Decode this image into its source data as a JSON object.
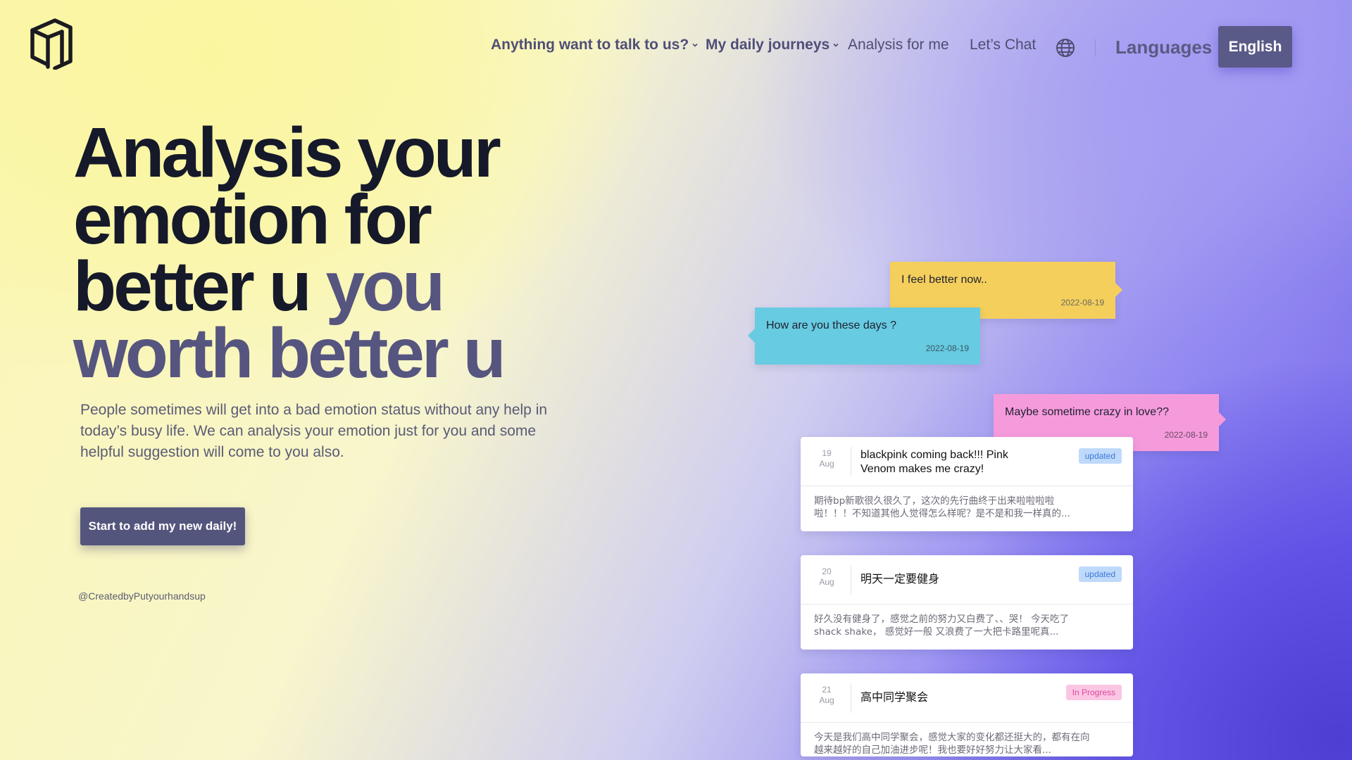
{
  "nav": {
    "items": [
      {
        "label": "Anything want to talk to us?",
        "has_dropdown": true
      },
      {
        "label": "My daily journeys",
        "has_dropdown": true
      },
      {
        "label": "Analysis for me",
        "has_dropdown": false
      },
      {
        "label": "Let’s Chat",
        "has_dropdown": false
      }
    ],
    "globe_icon": "globe-icon",
    "languages_label": "Languages",
    "language_button": "English"
  },
  "hero": {
    "title_line1": "Analysis your",
    "title_line2": "emotion for",
    "title_line3_dark": "better u ",
    "title_line3_accent": "you",
    "title_line4_accent": "worth better u",
    "description": "People sometimes will get into a bad emotion status without any help in today’s busy life. We can analysis your emotion just for you and some helpful suggestion will come to you also.",
    "cta_label": "Start to add my new daily!",
    "credit": "@CreatedbyPutyourhandsup"
  },
  "colors": {
    "accent": "#56557f",
    "bubble_yellow": "#f5cf5c",
    "bubble_blue": "#67cbe1",
    "bubble_pink": "#f59bdc",
    "badge_updated": "#3d78d6",
    "badge_in_progress": "#e04a9a"
  },
  "bubbles": [
    {
      "text": "I feel better now..",
      "date": "2022-08-19"
    },
    {
      "text": "How are you these days ?",
      "date": "2022-08-19"
    },
    {
      "text": "Maybe sometime crazy in love??",
      "date": "2022-08-19"
    }
  ],
  "cards": [
    {
      "day": "19",
      "month": "Aug",
      "title": "blackpink coming back!!! Pink Venom makes me crazy!",
      "badge": "updated",
      "body": "期待bp新歌很久很久了，这次的先行曲终于出来啦啦啦啦啦！！！不知道其他人觉得怎么样呢？是不是和我一样真的..."
    },
    {
      "day": "20",
      "month": "Aug",
      "title": "明天一定要健身",
      "badge": "updated",
      "body": "好久没有健身了，感觉之前的努力又白费了、、哭！ 今天吃了shack shake， 感觉好一般 又浪费了一大把卡路里呢真..."
    },
    {
      "day": "21",
      "month": "Aug",
      "title": "高中同学聚会",
      "badge": "In Progress",
      "body": "今天是我们高中同学聚会，感觉大家的变化都还挺大的，都有在向越来越好的自己加油进步呢！我也要好好努力让大家看..."
    }
  ]
}
